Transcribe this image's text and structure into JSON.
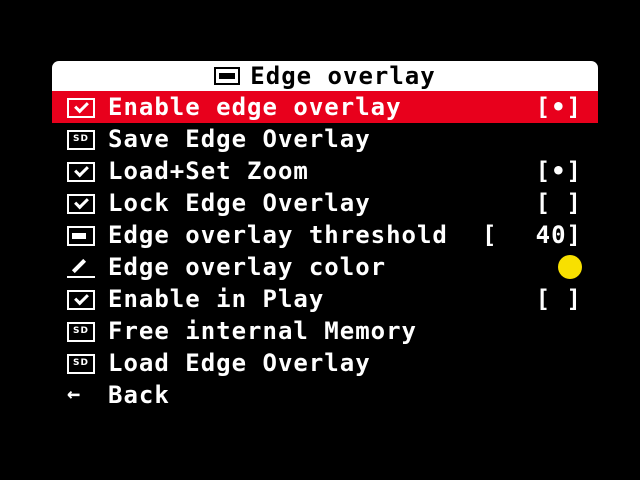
{
  "menu": {
    "title": "Edge overlay",
    "title_icon": "osd-icon",
    "colors": {
      "selected_bg": "#e8001c",
      "title_bg": "#ffffff",
      "swatch": "#f8e000"
    },
    "items": [
      {
        "icon": "checkbox-icon",
        "label": "Enable edge overlay",
        "value": "[•]",
        "selected": true
      },
      {
        "icon": "sd-card-icon",
        "label": "Save Edge Overlay",
        "value": ""
      },
      {
        "icon": "checkbox-icon",
        "label": "Load+Set Zoom",
        "value": "[•]"
      },
      {
        "icon": "checkbox-icon",
        "label": "Lock Edge Overlay",
        "value": "[ ]"
      },
      {
        "icon": "slider-icon",
        "label": "Edge overlay threshold",
        "value_open": "[",
        "value_num": "40]"
      },
      {
        "icon": "pen-icon",
        "label": "Edge overlay color",
        "value": ""
      },
      {
        "icon": "checkbox-icon",
        "label": "Enable in Play",
        "value": "[ ]"
      },
      {
        "icon": "sd-card-icon",
        "label": "Free internal Memory",
        "value": ""
      },
      {
        "icon": "sd-card-icon",
        "label": "Load Edge Overlay",
        "value": ""
      },
      {
        "icon": "back-arrow-icon",
        "label": "Back",
        "value": ""
      }
    ]
  }
}
